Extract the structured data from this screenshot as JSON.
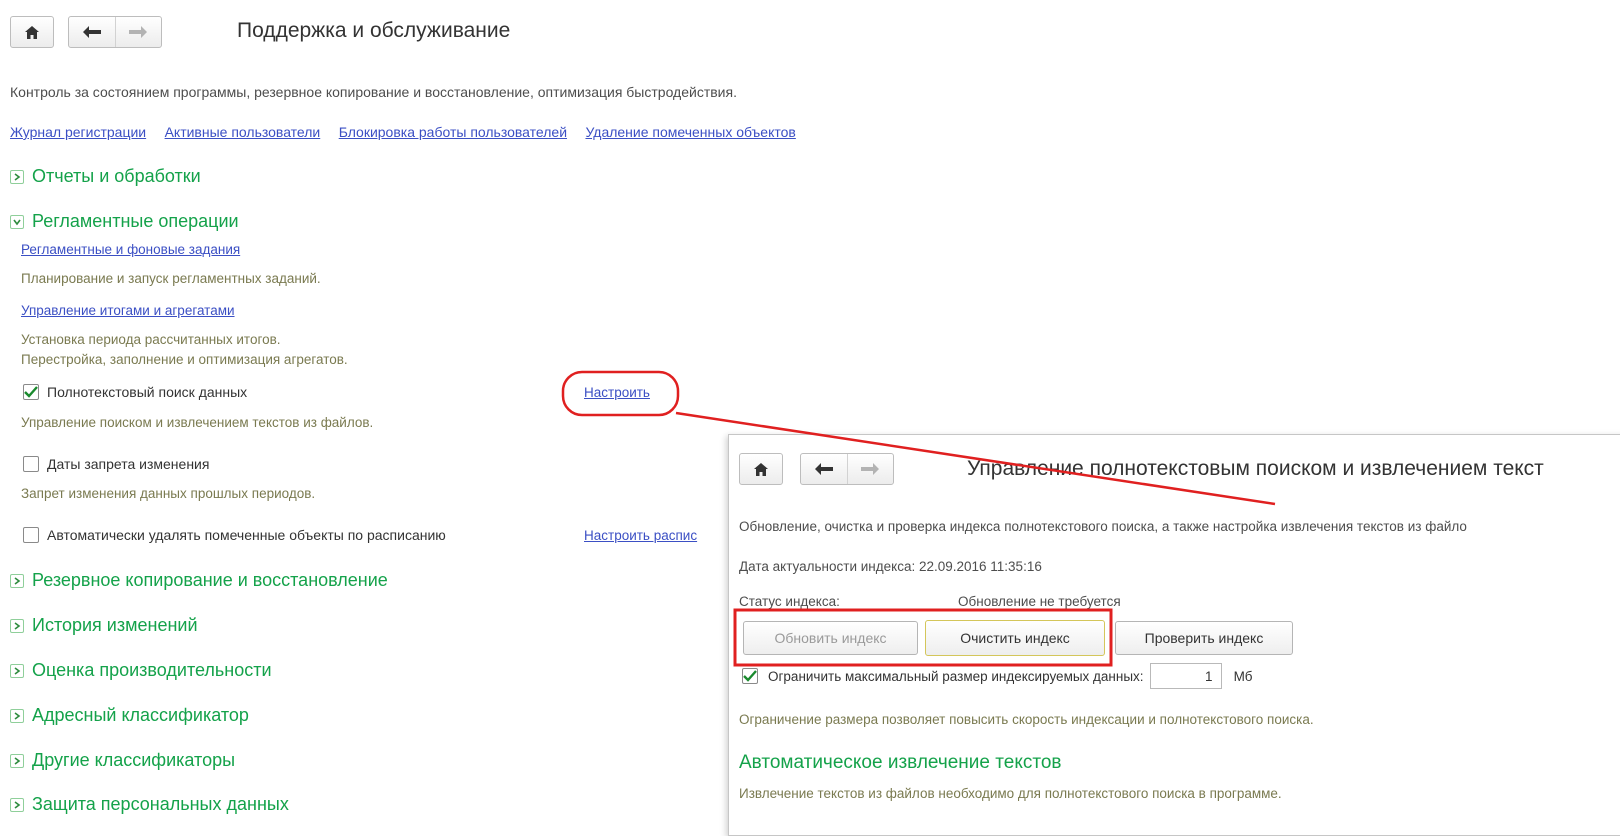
{
  "header": {
    "title": "Поддержка и обслуживание",
    "description": "Контроль за состоянием программы, резервное копирование и восстановление, оптимизация быстродействия."
  },
  "links": [
    "Журнал регистрации",
    "Активные пользователи",
    "Блокировка работы пользователей",
    "Удаление помеченных объектов"
  ],
  "sections": {
    "reports": "Отчеты и обработки",
    "routine": "Регламентные операции",
    "backup": "Резервное копирование и восстановление",
    "history": "История изменений",
    "performance": "Оценка производительности",
    "address": "Адресный классификатор",
    "other": "Другие классификаторы",
    "personal": "Защита персональных данных"
  },
  "routine": {
    "jobs_link": "Регламентные и фоновые задания",
    "jobs_desc": "Планирование и запуск регламентных заданий.",
    "totals_link": "Управление итогами и агрегатами",
    "totals_desc_1": "Установка периода рассчитанных итогов.",
    "totals_desc_2": "Перестройка, заполнение и оптимизация агрегатов.",
    "fulltext_label": "Полнотекстовый поиск данных",
    "fulltext_checked": true,
    "fulltext_configure": "Настроить",
    "fulltext_desc": "Управление поиском и извлечением текстов из файлов.",
    "lock_dates_label": "Даты запрета изменения",
    "lock_dates_checked": false,
    "lock_dates_desc": "Запрет изменения данных прошлых периодов.",
    "auto_delete_label": "Автоматически удалять помеченные объекты по расписанию",
    "auto_delete_checked": false,
    "auto_delete_configure": "Настроить распис"
  },
  "panel": {
    "title": "Управление полнотекстовым поиском и извлечением текст",
    "description": "Обновление, очистка и проверка индекса полнотекстового поиска, а также настройка извлечения текстов из файло",
    "index_date_label": "Дата актуальности индекса:",
    "index_date_value": "22.09.2016 11:35:16",
    "status_label": "Статус индекса:",
    "status_value": "Обновление не требуется",
    "btn_update": "Обновить индекс",
    "btn_clear": "Очистить индекс",
    "btn_check": "Проверить индекс",
    "limit_label": "Ограничить максимальный размер индексируемых данных:",
    "limit_checked": true,
    "limit_value": "1",
    "limit_unit": "Мб",
    "limit_desc": "Ограничение размера позволяет повысить скорость индексации и полнотекстового поиска.",
    "auto_extract_title": "Автоматическое извлечение текстов",
    "auto_extract_desc": "Извлечение текстов из файлов необходимо для полнотекстового поиска в программе."
  },
  "colors": {
    "link": "#3b4fc4",
    "section_green": "#14a24a",
    "annotation_red": "#e02020"
  },
  "icons": [
    "home-icon",
    "arrow-left-icon",
    "arrow-right-icon",
    "chevron-right-icon",
    "chevron-down-icon",
    "checkmark-icon"
  ]
}
